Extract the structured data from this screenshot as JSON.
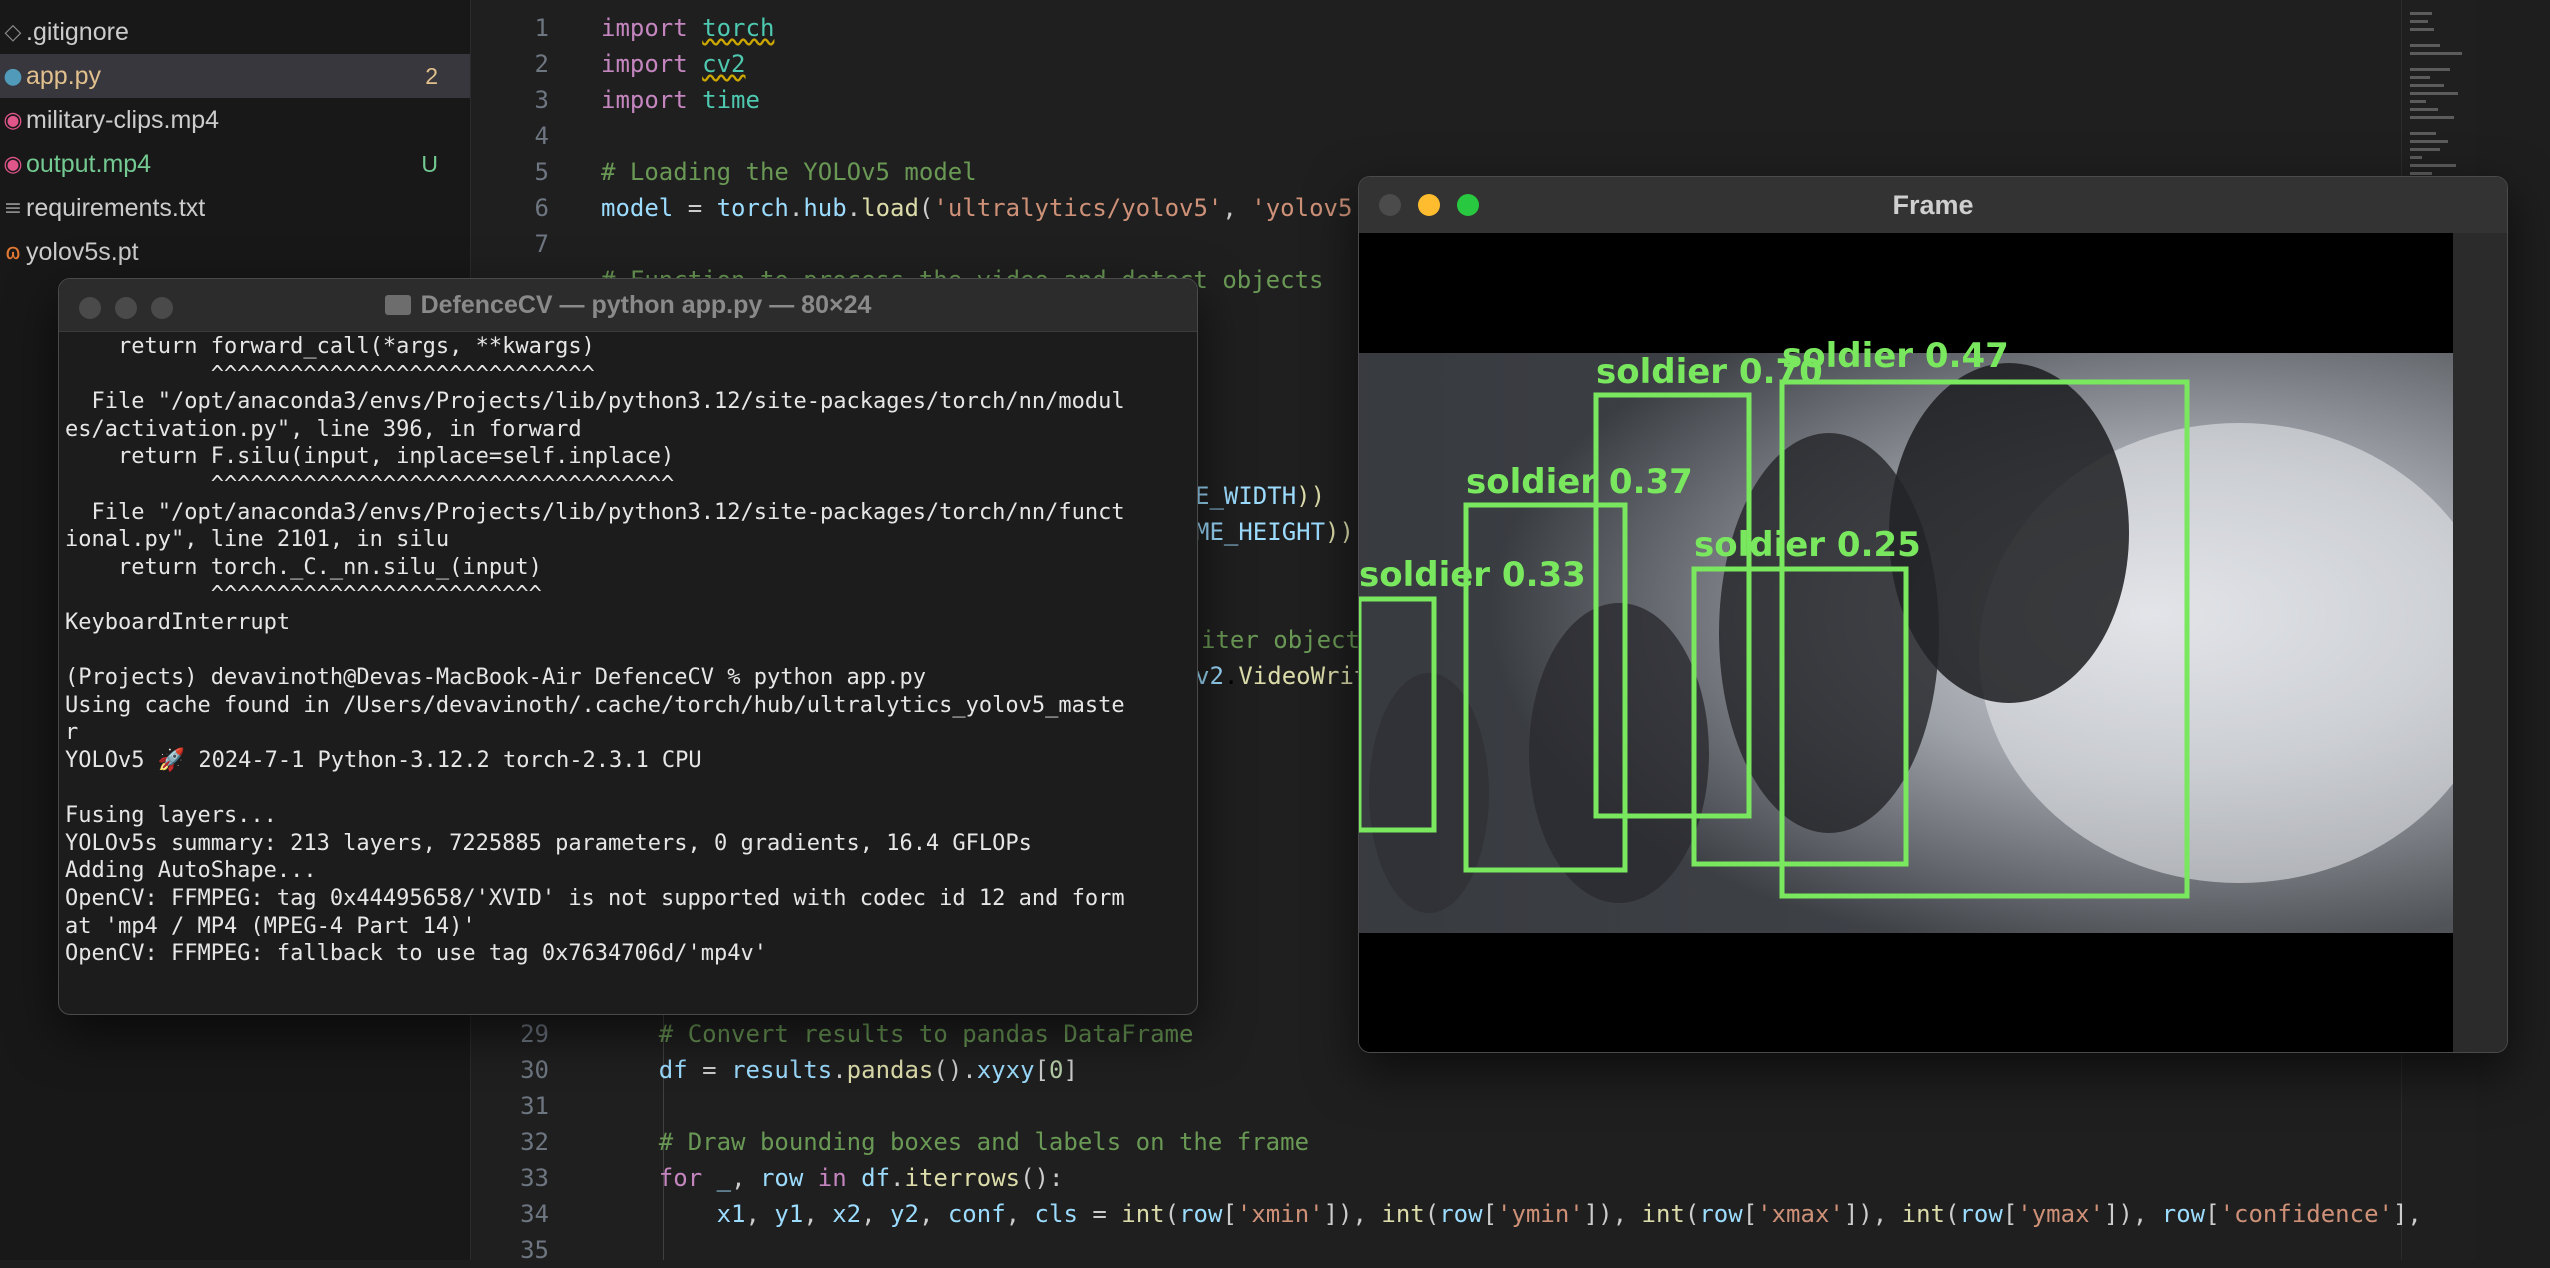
{
  "explorer": {
    "files": [
      {
        "name": ".gitignore",
        "icon": "gitignore-icon",
        "glyph": "◇",
        "color": "#cccccc",
        "badge": ""
      },
      {
        "name": "app.py",
        "icon": "python-file-icon",
        "glyph": "●",
        "color": "#e2c08d",
        "badge": "2",
        "badge_color": "#e2c08d",
        "active": true
      },
      {
        "name": "military-clips.mp4",
        "icon": "video-file-icon",
        "glyph": "◉",
        "color": "#cccccc",
        "badge": ""
      },
      {
        "name": "output.mp4",
        "icon": "video-file-icon",
        "glyph": "◉",
        "color": "#73c991",
        "badge": "U",
        "badge_color": "#73c991"
      },
      {
        "name": "requirements.txt",
        "icon": "text-file-icon",
        "glyph": "≡",
        "color": "#cccccc",
        "badge": ""
      },
      {
        "name": "yolov5s.pt",
        "icon": "model-file-icon",
        "glyph": "ɷ",
        "color": "#cccccc",
        "badge": ""
      }
    ]
  },
  "editor": {
    "lines": [
      {
        "n": "1",
        "html": "<span class='kw'>import</span> <span class='mod squiggle'>torch</span>"
      },
      {
        "n": "2",
        "html": "<span class='kw'>import</span> <span class='mod squiggle'>cv2</span>"
      },
      {
        "n": "3",
        "html": "<span class='kw'>import</span> <span class='mod'>time</span>"
      },
      {
        "n": "4",
        "html": ""
      },
      {
        "n": "5",
        "html": "<span class='cm'># Loading the YOLOv5 model</span>"
      },
      {
        "n": "6",
        "html": "<span class='var'>model</span> = <span class='var'>torch</span>.<span class='var'>hub</span>.<span class='fn'>load</span>(<span class='str'>'ultralytics/yolov5'</span>, <span class='str'>'yolov5</span>"
      },
      {
        "n": "7",
        "html": ""
      },
      {
        "n": "",
        "html": "<span class='cm'># Function to process the video and detect objects</span>"
      }
    ],
    "partial_line_width": "<span class='var'>E_WIDTH</span><span class='fn'>))</span>",
    "partial_line_height": "<span class='var'>ME_HEIGHT</span><span class='fn'>))</span>",
    "partial_line_writer_comment": "<span class='cm'>iter object</span>",
    "partial_line_writer_code": "<span class='var'>v2</span>.<span class='fn'>VideoWrit</span>",
    "lower_lines": [
      {
        "n": "29",
        "html": "    <span class='cm'># Convert results to pandas DataFrame</span>"
      },
      {
        "n": "30",
        "html": "    <span class='var'>df</span> = <span class='var'>results</span>.<span class='fn'>pandas</span>().<span class='var'>xyxy</span>[<span class='num'>0</span>]"
      },
      {
        "n": "31",
        "html": ""
      },
      {
        "n": "32",
        "html": "    <span class='cm'># Draw bounding boxes and labels on the frame</span>"
      },
      {
        "n": "33",
        "html": "    <span class='kw'>for</span> <span class='var'>_</span>, <span class='var'>row</span> <span class='kw'>in</span> <span class='var'>df</span>.<span class='fn'>iterrows</span>():"
      },
      {
        "n": "34",
        "html": "        <span class='var'>x1</span>, <span class='var'>y1</span>, <span class='var'>x2</span>, <span class='var'>y2</span>, <span class='var'>conf</span>, <span class='var'>cls</span> = <span class='fn'>int</span>(<span class='var'>row</span>[<span class='str'>'xmin'</span>]), <span class='fn'>int</span>(<span class='var'>row</span>[<span class='str'>'ymin'</span>]), <span class='fn'>int</span>(<span class='var'>row</span>[<span class='str'>'xmax'</span>]), <span class='fn'>int</span>(<span class='var'>row</span>[<span class='str'>'ymax'</span>]), <span class='var'>row</span>[<span class='str'>'confidence'</span>],"
      },
      {
        "n": "35",
        "html": ""
      }
    ]
  },
  "terminal": {
    "title": "DefenceCV — python app.py — 80×24",
    "lines": [
      "    return forward_call(*args, **kwargs)",
      "           ^^^^^^^^^^^^^^^^^^^^^^^^^^^^^",
      "  File \"/opt/anaconda3/envs/Projects/lib/python3.12/site-packages/torch/nn/modul",
      "es/activation.py\", line 396, in forward",
      "    return F.silu(input, inplace=self.inplace)",
      "           ^^^^^^^^^^^^^^^^^^^^^^^^^^^^^^^^^^^",
      "  File \"/opt/anaconda3/envs/Projects/lib/python3.12/site-packages/torch/nn/funct",
      "ional.py\", line 2101, in silu",
      "    return torch._C._nn.silu_(input)",
      "           ^^^^^^^^^^^^^^^^^^^^^^^^^",
      "KeyboardInterrupt",
      "",
      "(Projects) devavinoth@Devas-MacBook-Air DefenceCV % python app.py",
      "Using cache found in /Users/devavinoth/.cache/torch/hub/ultralytics_yolov5_maste",
      "r",
      "YOLOv5 🚀 2024-7-1 Python-3.12.2 torch-2.3.1 CPU",
      "",
      "Fusing layers...",
      "YOLOv5s summary: 213 layers, 7225885 parameters, 0 gradients, 16.4 GFLOPs",
      "Adding AutoShape...",
      "OpenCV: FFMPEG: tag 0x44495658/'XVID' is not supported with codec id 12 and form",
      "at 'mp4 / MP4 (MPEG-4 Part 14)'",
      "OpenCV: FFMPEG: fallback to use tag 0x7634706d/'mp4v'"
    ]
  },
  "frame_window": {
    "title": "Frame",
    "detections": [
      {
        "label": "soldier 0.70"
      },
      {
        "label": "soldier 0.47"
      },
      {
        "label": "soldier 0.37"
      },
      {
        "label": "soldier 0.25"
      },
      {
        "label": "soldier 0.33"
      }
    ]
  },
  "colors": {
    "detection": "#7ae85e",
    "traffic_close": "#ff5f57",
    "traffic_min": "#febc2e",
    "traffic_max": "#28c840"
  }
}
